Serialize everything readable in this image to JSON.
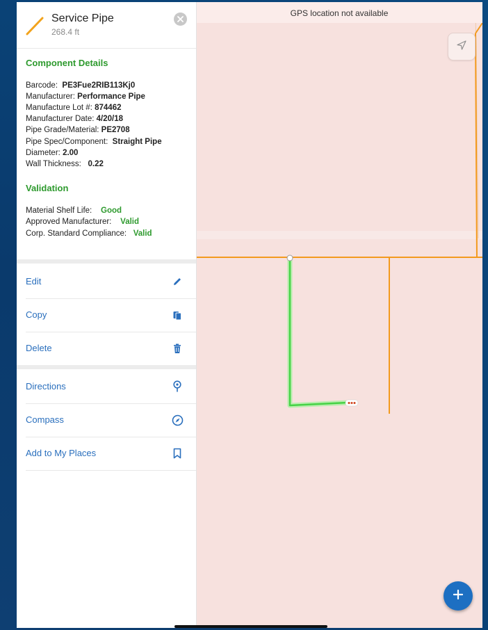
{
  "panel": {
    "title": "Service Pipe",
    "length": "268.4 ft",
    "component_details": {
      "heading": "Component Details",
      "rows": [
        {
          "label": "Barcode:",
          "value": "PE3Fue2RIB113Kj0"
        },
        {
          "label": "Manufacturer:",
          "value": "Performance Pipe"
        },
        {
          "label": "Manufacture Lot #:",
          "value": "874462"
        },
        {
          "label": "Manufacturer Date:",
          "value": "4/20/18"
        },
        {
          "label": "Pipe Grade/Material:",
          "value": "PE2708"
        },
        {
          "label": "Pipe Spec/Component:",
          "value": "Straight Pipe"
        },
        {
          "label": "Diameter:",
          "value": "2.00"
        },
        {
          "label": "Wall Thickness:",
          "value": "0.22"
        }
      ]
    },
    "validation": {
      "heading": "Validation",
      "rows": [
        {
          "label": "Material Shelf Life:",
          "value": "Good"
        },
        {
          "label": "Approved Manufacturer:",
          "value": "Valid"
        },
        {
          "label": "Corp. Standard Compliance:",
          "value": "Valid"
        }
      ]
    },
    "actions": [
      {
        "label": "Edit",
        "icon": "pencil-icon"
      },
      {
        "label": "Copy",
        "icon": "copy-icon"
      },
      {
        "label": "Delete",
        "icon": "trash-icon"
      }
    ],
    "nav_actions": [
      {
        "label": "Directions",
        "icon": "directions-pin-icon"
      },
      {
        "label": "Compass",
        "icon": "compass-icon"
      },
      {
        "label": "Add to My Places",
        "icon": "bookmark-icon"
      }
    ]
  },
  "map": {
    "gps_banner": "GPS location not available"
  },
  "colors": {
    "accent": "#2a6fbd",
    "valid_green": "#2e9a2e",
    "pipe_orange": "#f39a1e",
    "selection_green": "#46d246",
    "map_background": "#f7e1de"
  }
}
